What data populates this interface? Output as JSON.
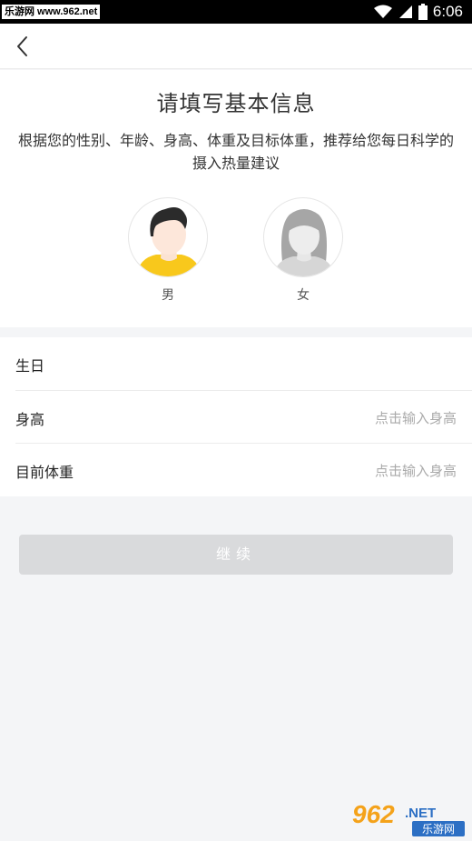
{
  "status_bar": {
    "watermark_text": "乐游网 www.962.net",
    "time": "6:06",
    "icons": [
      "wifi-icon",
      "signal-icon",
      "battery-icon"
    ]
  },
  "header": {
    "back_icon": "chevron-left-icon"
  },
  "intro": {
    "title": "请填写基本信息",
    "subtitle": "根据您的性别、年龄、身高、体重及目标体重，推荐给您每日科学的摄入热量建议"
  },
  "gender": {
    "male_label": "男",
    "female_label": "女"
  },
  "form": {
    "rows": [
      {
        "label": "生日",
        "value": ""
      },
      {
        "label": "身高",
        "value": "点击输入身高"
      },
      {
        "label": "目前体重",
        "value": "点击输入身高"
      }
    ]
  },
  "actions": {
    "continue_label": "继续"
  },
  "watermark": {
    "number": "962",
    "suffix": ".NET",
    "name": "乐游网"
  },
  "colors": {
    "accent_yellow": "#f8c81c",
    "button_disabled": "#d9dadc",
    "page_bg": "#f4f5f7"
  }
}
